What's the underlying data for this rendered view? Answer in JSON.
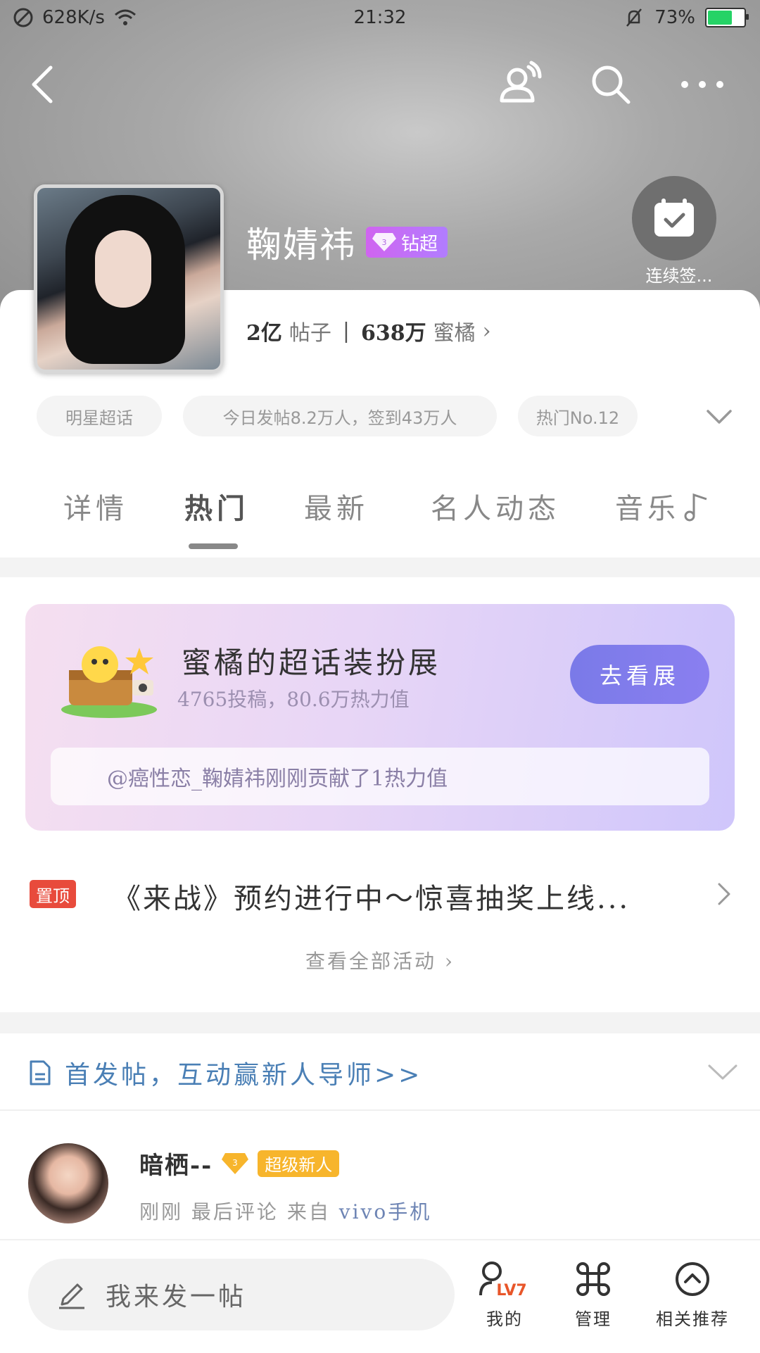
{
  "status_bar": {
    "net_speed": "628K/s",
    "time": "21:32",
    "battery": "73%",
    "battery_level": 0.73
  },
  "header": {
    "back_icon": "chevron-left-icon",
    "actions": [
      "follow-user-icon",
      "search-icon",
      "more-icon"
    ]
  },
  "profile": {
    "name": "鞠婧祎",
    "badge_label": "钻超",
    "checkin_label": "连续签...",
    "posts_count": "2亿",
    "posts_label": "帖子",
    "fans_count": "638万",
    "fans_label": "蜜橘",
    "fans_arrow": "›"
  },
  "chips": [
    "明星超话",
    "今日发帖8.2万人，签到43万人",
    "热门No.12"
  ],
  "tabs": [
    "详情",
    "热门",
    "最新",
    "名人动态",
    "音乐"
  ],
  "active_tab": "热门",
  "exhibition": {
    "title": "蜜橘的超话装扮展",
    "subtitle": "4765投稿，80.6万热力值",
    "button": "去看展",
    "ticker": "@癌性恋_鞠婧祎刚刚贡献了1热力值"
  },
  "pinned": {
    "tag": "置顶",
    "title": "《来战》预约进行中～惊喜抽奖上线...",
    "view_all": "查看全部活动"
  },
  "notice": {
    "text": "首发帖，互动赢新人导师>>"
  },
  "comment": {
    "user": "暗栖--",
    "badge": "超级新人",
    "time": "刚刚",
    "action": "最后评论",
    "from_label": "来自",
    "device": "vivo手机"
  },
  "bottom_bar": {
    "input_placeholder": "我来发一帖",
    "level": "LV7",
    "nav": [
      "我的",
      "管理",
      "相关推荐"
    ]
  },
  "colors": {
    "accent_purple": "#8a7ff0",
    "pin_red": "#e84b3c",
    "badge_gold": "#f7b52c",
    "notice_blue": "#4a7fb5"
  }
}
